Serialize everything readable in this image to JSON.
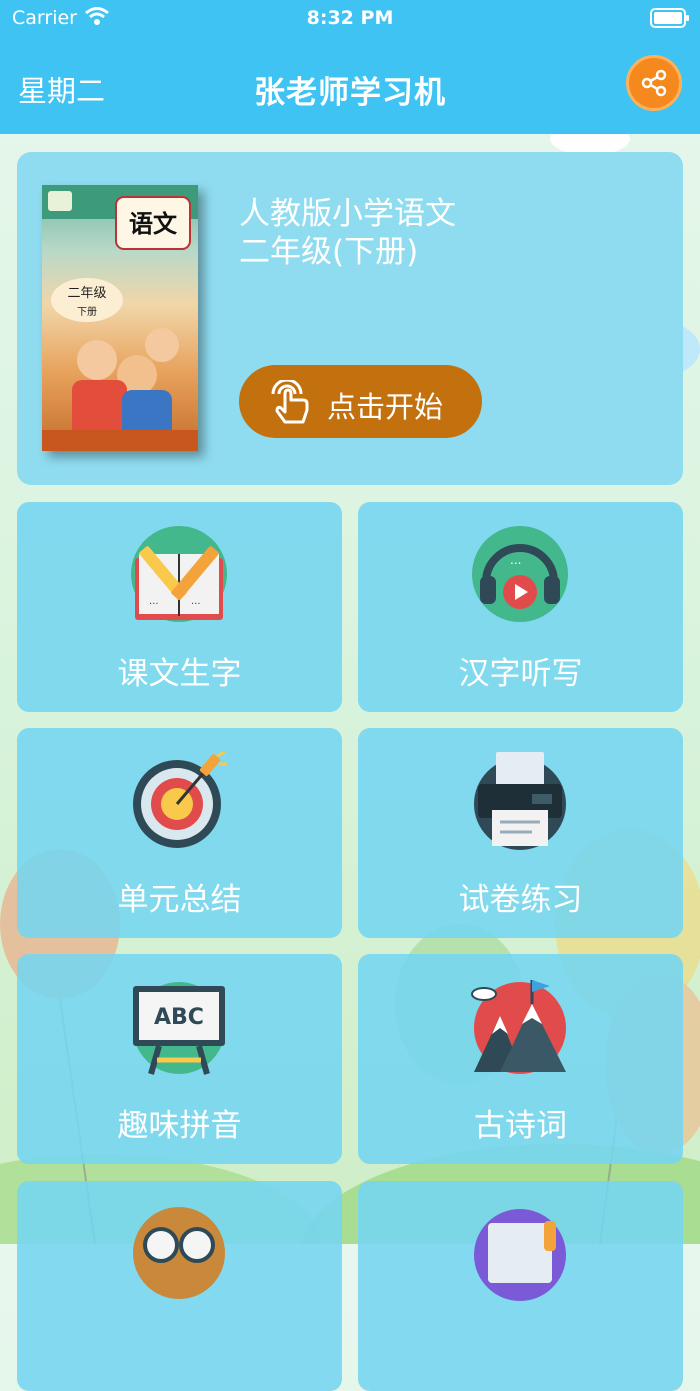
{
  "status_bar": {
    "carrier": "Carrier",
    "time": "8:32 PM"
  },
  "nav": {
    "weekday": "星期二",
    "title": "张老师学习机",
    "share_icon": "share-icon"
  },
  "book": {
    "title_line1": "人教版小学语文",
    "title_line2": "二年级(下册)",
    "cover_title": "语文",
    "cover_grade": "二年级",
    "cover_volume": "下册",
    "start_label": "点击开始",
    "start_icon": "tap-hand-icon"
  },
  "tiles": [
    {
      "label": "课文生字",
      "icon": "book-pencil-icon"
    },
    {
      "label": "汉字听写",
      "icon": "headphones-play-icon"
    },
    {
      "label": "单元总结",
      "icon": "target-pencil-icon"
    },
    {
      "label": "试卷练习",
      "icon": "printer-icon"
    },
    {
      "label": "趣味拼音",
      "icon": "abc-board-icon"
    },
    {
      "label": "古诗词",
      "icon": "mountain-flag-icon"
    }
  ],
  "colors": {
    "nav": "#3fc3f3",
    "share": "#f5891d",
    "start_button": "#c3700e",
    "card": "#8fdcf0"
  }
}
